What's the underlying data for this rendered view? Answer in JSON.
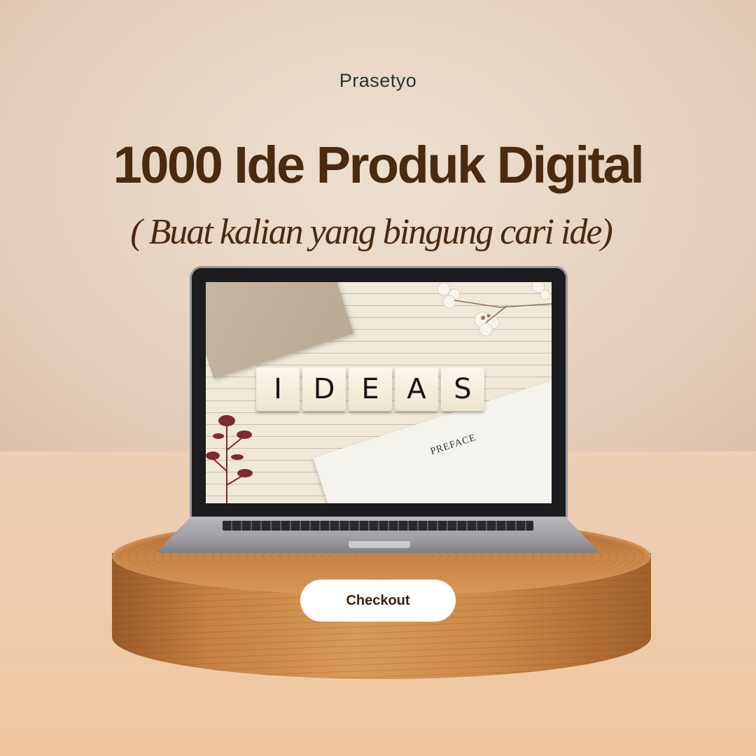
{
  "brand": "Prasetyo",
  "headline": "1000 Ide Produk Digital",
  "subheadline": "( Buat kalian yang bingung cari ide)",
  "screen": {
    "tiles": [
      "I",
      "D",
      "E",
      "A",
      "S"
    ],
    "preface": "PREFACE"
  },
  "cta": {
    "label": "Checkout"
  },
  "colors": {
    "heading": "#4a2a10",
    "brand_text": "#24372f",
    "button_bg": "#ffffff",
    "background": "#ead8c8"
  }
}
